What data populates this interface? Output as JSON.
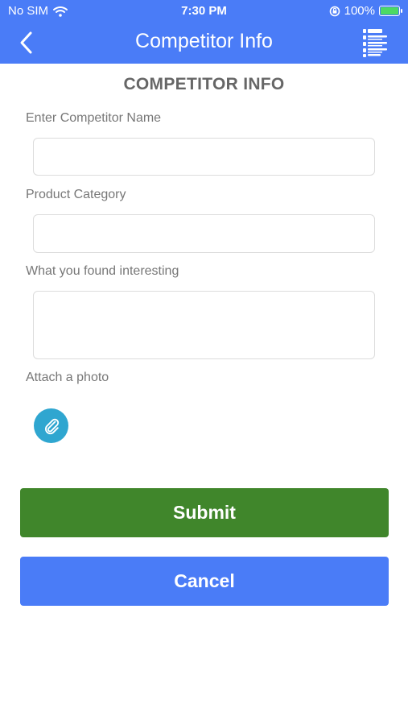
{
  "status_bar": {
    "carrier": "No SIM",
    "time": "7:30 PM",
    "battery_percent": "100%",
    "battery_level": 1.0,
    "icons": [
      "wifi-icon",
      "orientation-lock-icon",
      "battery-charging-icon"
    ]
  },
  "nav": {
    "title": "Competitor Info",
    "back_icon": "chevron-left-icon",
    "menu_icon": "list-icon"
  },
  "form": {
    "heading": "COMPETITOR INFO",
    "competitor_name": {
      "label": "Enter Competitor Name",
      "value": "",
      "placeholder": ""
    },
    "product_category": {
      "label": "Product Category",
      "value": "",
      "placeholder": ""
    },
    "interesting": {
      "label": "What you found interesting",
      "value": "",
      "placeholder": ""
    },
    "attach": {
      "label": "Attach a photo",
      "icon": "paperclip-icon"
    }
  },
  "buttons": {
    "submit": "Submit",
    "cancel": "Cancel"
  },
  "colors": {
    "header": "#4a7cf7",
    "submit": "#40862b",
    "cancel": "#4a7cf7",
    "attach": "#2fa6d0",
    "battery_fill": "#4cd964"
  }
}
